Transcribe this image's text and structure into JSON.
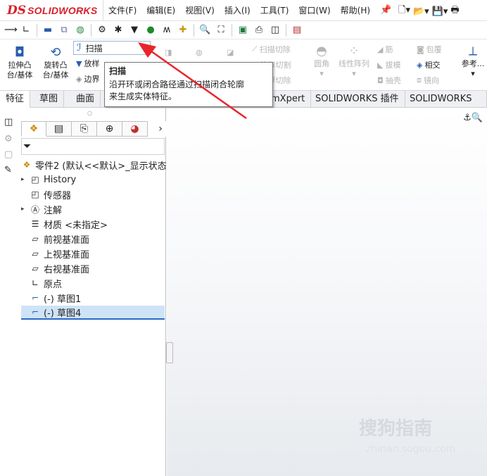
{
  "titlebar": {
    "logo_ds": "DS",
    "logo_text": "SOLIDWORKS",
    "menus": [
      "文件(F)",
      "编辑(E)",
      "视图(V)",
      "插入(I)",
      "工具(T)",
      "窗口(W)",
      "帮助(H)"
    ],
    "pin_icon": "pin-icon"
  },
  "ribbon": {
    "extrude_boss": "拉伸凸\n台/基体",
    "revolve_boss": "旋转凸\n台/基体",
    "sweep": "扫描",
    "loft": "放样",
    "boundary": "边界",
    "swept_cut": "扫描切除",
    "lofted_cut": "放样切割",
    "boundary_cut": "边界切除",
    "fillet": "圆角",
    "linear_pattern": "线性阵列",
    "rib": "筋",
    "draft": "拔模",
    "shell": "抽壳",
    "wrap": "包覆",
    "intersect": "相交",
    "mirror": "镜向",
    "reference": "参考..."
  },
  "tooltip": {
    "title": "扫描",
    "body_line1": "沿开环或闭合路径通过扫描闭合轮廓",
    "body_line2": "来生成实体特征。"
  },
  "tabs": [
    "特征",
    "草图",
    "曲面",
    "mXpert",
    "SOLIDWORKS 插件",
    "SOLIDWORKS MBD"
  ],
  "tree": {
    "part": "零件2 (默认<<默认>_显示状态",
    "items": [
      "History",
      "传感器",
      "注解",
      "材质 <未指定>",
      "前视基准面",
      "上视基准面",
      "右视基准面",
      "原点",
      "(-) 草图1",
      "(-) 草图4"
    ]
  },
  "watermark": {
    "main": "搜狗指南",
    "sub": "zhinan.sogou.com"
  }
}
